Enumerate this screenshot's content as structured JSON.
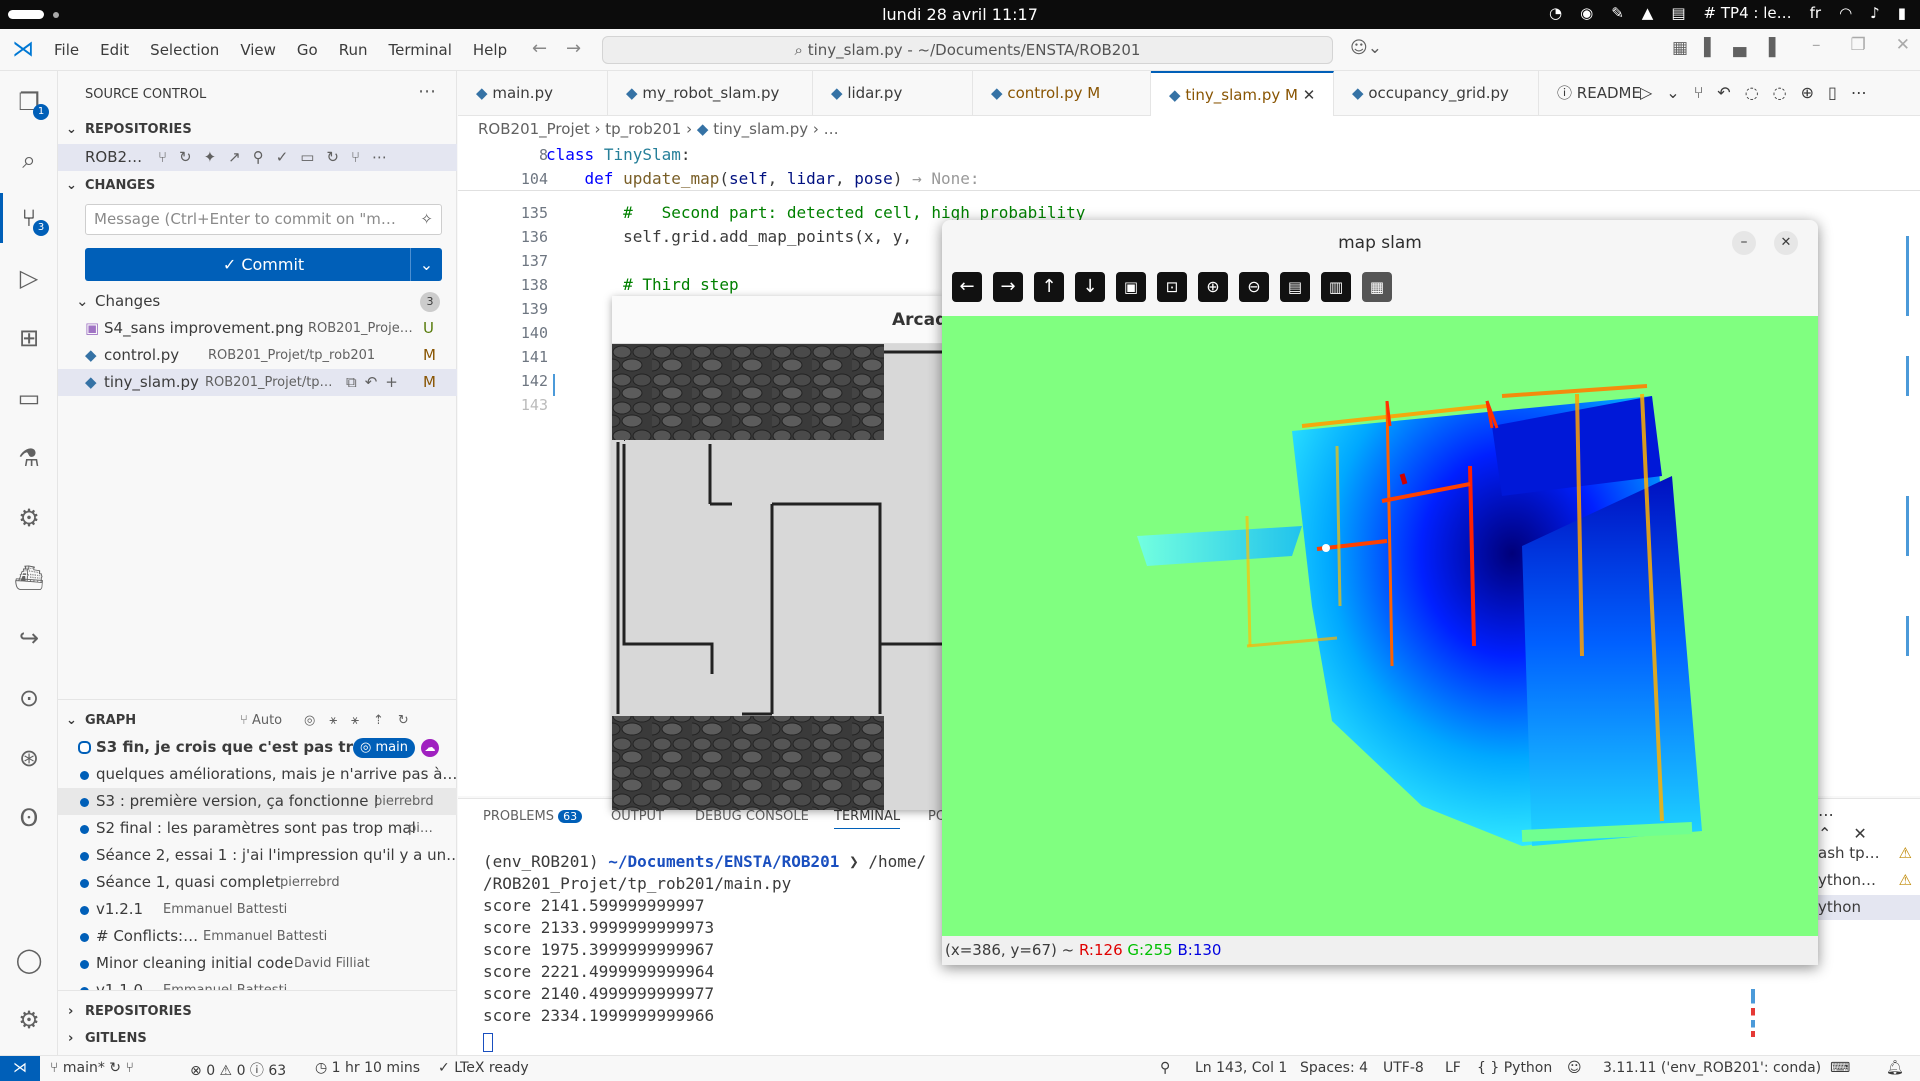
{
  "os": {
    "clock": "lundi 28 avril 11:17",
    "tray_window": "# TP4 : le…",
    "tray_lang": "fr"
  },
  "menubar": {
    "items": [
      "File",
      "Edit",
      "Selection",
      "View",
      "Go",
      "Run",
      "Terminal",
      "Help"
    ],
    "search": "tiny_slam.py - ~/Documents/ENSTA/ROB201"
  },
  "activity": {
    "explorer_badge": "1",
    "scm_badge": "3"
  },
  "sidebar": {
    "title": "SOURCE CONTROL",
    "repositories_label": "REPOSITORIES",
    "repo_name": "ROB2…",
    "changes_label": "CHANGES",
    "commit_placeholder": "Message (Ctrl+Enter to commit on \"m…",
    "commit_button": "✓ Commit",
    "changes_group": "Changes",
    "changes_count": "3",
    "files": [
      {
        "name": "S4_sans improvement.png",
        "path": "ROB201_Proje…",
        "status": "U"
      },
      {
        "name": "control.py",
        "path": "ROB201_Projet/tp_rob201",
        "status": "M"
      },
      {
        "name": "tiny_slam.py",
        "path": "ROB201_Projet/tp…",
        "status": "M"
      }
    ],
    "graph_label": "GRAPH",
    "graph_auto": "Auto",
    "graph_branch": "main",
    "commits": [
      {
        "msg": "S3 fin, je crois que c'est pas tro…",
        "author": ""
      },
      {
        "msg": "quelques améliorations, mais je n'arrive pas à…",
        "author": ""
      },
      {
        "msg": "S3 :  première version, ça fonctionne !",
        "author": "pierrebrd"
      },
      {
        "msg": "S2 final : les paramètres sont pas trop mal",
        "author": "pi…"
      },
      {
        "msg": "Séance 2, essai 1 : j'ai l'impression qu'il y a un…",
        "author": ""
      },
      {
        "msg": "Séance 1, quasi complet",
        "author": "pierrebrd"
      },
      {
        "msg": "v1.2.1",
        "author": "Emmanuel Battesti"
      },
      {
        "msg": "# Conflicts:…",
        "author": "Emmanuel Battesti"
      },
      {
        "msg": "Minor cleaning initial code",
        "author": "David Filliat"
      },
      {
        "msg": "v1.1.0",
        "author": "Emmanuel Battesti"
      }
    ],
    "repositories_footer": "REPOSITORIES",
    "gitlens_footer": "GITLENS"
  },
  "tabs": [
    {
      "label": "main.py",
      "mod": ""
    },
    {
      "label": "my_robot_slam.py",
      "mod": ""
    },
    {
      "label": "lidar.py",
      "mod": ""
    },
    {
      "label": "control.py",
      "mod": "M"
    },
    {
      "label": "tiny_slam.py",
      "mod": "M"
    },
    {
      "label": "occupancy_grid.py",
      "mod": ""
    },
    {
      "label": "README",
      "mod": ""
    }
  ],
  "breadcrumb": [
    "ROB201_Projet",
    "tp_rob201",
    "tiny_slam.py",
    "…"
  ],
  "sticky": [
    {
      "ln": "8",
      "code": "class TinySlam:"
    },
    {
      "ln": "104",
      "code": "    def update_map(self, lidar, pose) → None:"
    }
  ],
  "code_lines": [
    {
      "ln": "135",
      "code": "        #   Second part: detected cell, high probability"
    },
    {
      "ln": "136",
      "code": "        self.grid.add_map_points(x, y,"
    },
    {
      "ln": "137",
      "code": ""
    },
    {
      "ln": "138",
      "code": "        # Third step"
    },
    {
      "ln": "139",
      "code": ""
    },
    {
      "ln": "140",
      "code": ""
    },
    {
      "ln": "141",
      "code": ""
    },
    {
      "ln": "142",
      "code": ""
    },
    {
      "ln": "143",
      "code": ""
    }
  ],
  "panel": {
    "tabs": [
      "PROBLEMS",
      "OUTPUT",
      "DEBUG CONSOLE",
      "TERMINAL",
      "PO"
    ],
    "problems_count": "63",
    "prompt_env": "(env_ROB201)",
    "prompt_path": "~/Documents/ENSTA/ROB201",
    "prompt_cmd": "❯ /home/",
    "prompt_line2": "/ROB201_Projet/tp_rob201/main.py",
    "scores": [
      "score 2141.599999999997",
      "score 2133.9999999999973",
      "score 1975.3999999999967",
      "score 2221.4999999999964",
      "score 2140.4999999999977",
      "score 2334.1999999999966"
    ],
    "terminal_list": [
      "ash  tp…",
      "ython…",
      "ython"
    ]
  },
  "arcade": {
    "title": "Arcad"
  },
  "mapslam": {
    "title": "map slam",
    "coords": "(x=386, y=67) ~",
    "r": "R:126",
    "g": "G:255",
    "b": "B:130",
    "colors": {
      "background": "#80ff80",
      "free": "#0000c0",
      "occupied": "#ff0000"
    }
  },
  "status": {
    "branch": "main*",
    "errors": "0",
    "warnings": "0",
    "infos": "63",
    "time": "1 hr 10 mins",
    "ltex": "LTeX ready",
    "position": "Ln 143, Col 1",
    "spaces": "Spaces: 4",
    "encoding": "UTF-8",
    "eol": "LF",
    "language": "{ } Python",
    "interpreter": "3.11.11 ('env_ROB201': conda)"
  }
}
